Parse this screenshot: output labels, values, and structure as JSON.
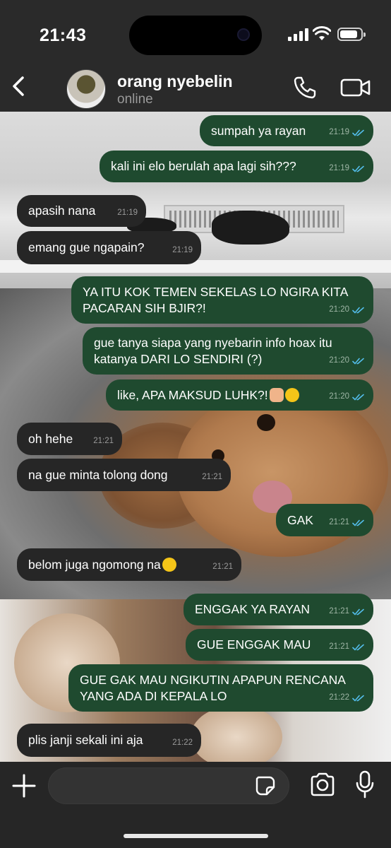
{
  "status_bar": {
    "time": "21:43",
    "battery_level": 0.85
  },
  "header": {
    "contact_name": "orang nyebelin",
    "contact_status": "online",
    "icons": {
      "back": "chevron-left-icon",
      "call": "phone-icon",
      "video": "video-camera-icon"
    }
  },
  "messages": [
    {
      "dir": "out",
      "text": "sumpah ya rayan",
      "time": "21:19",
      "read": true
    },
    {
      "dir": "out",
      "text": "kali ini elo berulah apa lagi sih???",
      "time": "21:19",
      "read": true
    },
    {
      "dir": "in",
      "text": "apasih nana",
      "time": "21:19"
    },
    {
      "dir": "in",
      "text": "emang gue ngapain?",
      "time": "21:19"
    },
    {
      "dir": "out",
      "text": "YA ITU KOK TEMEN SEKELAS LO NGIRA KITA\nPACARAN SIH BJIR?!",
      "time": "21:20",
      "read": true
    },
    {
      "dir": "out",
      "text": "gue tanya siapa yang nyebarin info hoax itu\nkatanya DARI LO SENDIRI (?)",
      "time": "21:20",
      "read": true
    },
    {
      "dir": "out",
      "text": "like, APA MAKSUD LUHK?!",
      "emoji": [
        "raised-fist-emoji",
        "smiley-emoji"
      ],
      "time": "21:20",
      "read": true
    },
    {
      "dir": "in",
      "text": "oh hehe",
      "time": "21:21"
    },
    {
      "dir": "in",
      "text": "na gue minta tolong dong",
      "time": "21:21"
    },
    {
      "dir": "out",
      "text": "GAK",
      "time": "21:21",
      "read": true
    },
    {
      "dir": "in",
      "text": "belom juga ngomong na",
      "emoji": [
        "pleading-face-emoji"
      ],
      "time": "21:21"
    },
    {
      "dir": "out",
      "text": "ENGGAK YA RAYAN",
      "time": "21:21",
      "read": true
    },
    {
      "dir": "out",
      "text": "GUE ENGGAK MAU",
      "time": "21:21",
      "read": true
    },
    {
      "dir": "out",
      "text": "GUE GAK MAU NGIKUTIN APAPUN RENCANA\nYANG ADA DI KEPALA LO",
      "time": "21:22",
      "read": true
    },
    {
      "dir": "in",
      "text": "plis janji sekali ini aja",
      "time": "21:22"
    }
  ],
  "input_bar": {
    "placeholder": "",
    "icons": {
      "attach": "plus-icon",
      "sticker": "sticker-icon",
      "camera": "camera-icon",
      "mic": "microphone-icon"
    }
  },
  "colors": {
    "outgoing_bubble": "#1f4a2f",
    "incoming_bubble": "#262626",
    "read_tick": "#53bdeb",
    "header_bg": "#2a2a2a"
  }
}
